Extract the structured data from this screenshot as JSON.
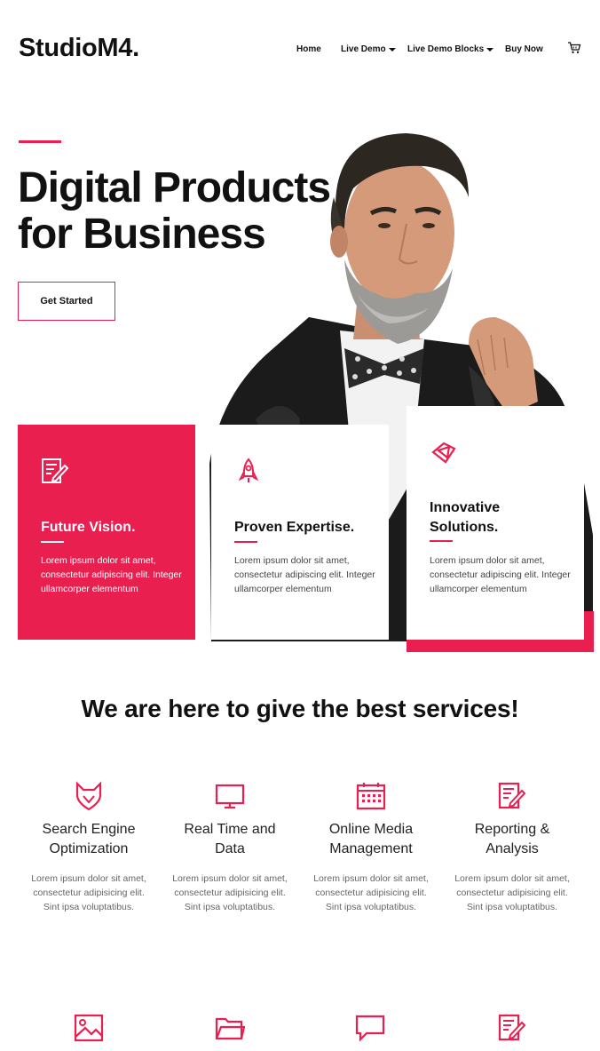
{
  "header": {
    "logo": "StudioM4.",
    "nav": [
      {
        "label": "Home"
      },
      {
        "label": "Live Demo"
      },
      {
        "label": "Live Demo Blocks"
      },
      {
        "label": "Buy Now"
      }
    ],
    "cart_icon": "cart-icon"
  },
  "hero": {
    "title": "Digital Products\nfor Business",
    "cta_label": "Get Started",
    "image": "man-in-leather-jacket-photo"
  },
  "features": [
    {
      "title": "Future Vision.",
      "text": "Lorem ipsum dolor sit amet, consectetur adipiscing elit. Integer ullamcorper elementum",
      "icon": "document-edit-icon"
    },
    {
      "title": "Proven Expertise.",
      "text": "Lorem ipsum dolor sit amet, consectetur adipiscing elit. Integer ullamcorper elementum",
      "icon": "rocket-icon"
    },
    {
      "title": "Innovative Solutions.",
      "text": "Lorem ipsum dolor sit amet, consectetur adipiscing elit. Integer ullamcorper elementum",
      "icon": "diamond-shapes-icon"
    }
  ],
  "services": {
    "title": "We are here to give the best services!",
    "items": [
      {
        "title": "Search Engine\nOptimization",
        "text": "Lorem ipsum dolor sit amet, consectetur adipisicing elit. Sint ipsa voluptatibus.",
        "icon": "fox-icon"
      },
      {
        "title": "Real Time and\nData",
        "text": "Lorem ipsum dolor sit amet, consectetur adipisicing elit. Sint ipsa voluptatibus.",
        "icon": "monitor-icon"
      },
      {
        "title": "Online Media\nManagement",
        "text": "Lorem ipsum dolor sit amet, consectetur adipisicing elit. Sint ipsa voluptatibus.",
        "icon": "calendar-icon"
      },
      {
        "title": "Reporting &\nAnalysis",
        "text": "Lorem ipsum dolor sit amet, consectetur adipisicing elit. Sint ipsa voluptatibus.",
        "icon": "document-edit-icon"
      }
    ],
    "row2_icons": [
      "image-icon",
      "folder-icon",
      "chat-bubble-icon",
      "document-edit-icon"
    ]
  },
  "colors": {
    "accent": "#e81f4f",
    "text": "#111111",
    "muted": "#666666"
  }
}
